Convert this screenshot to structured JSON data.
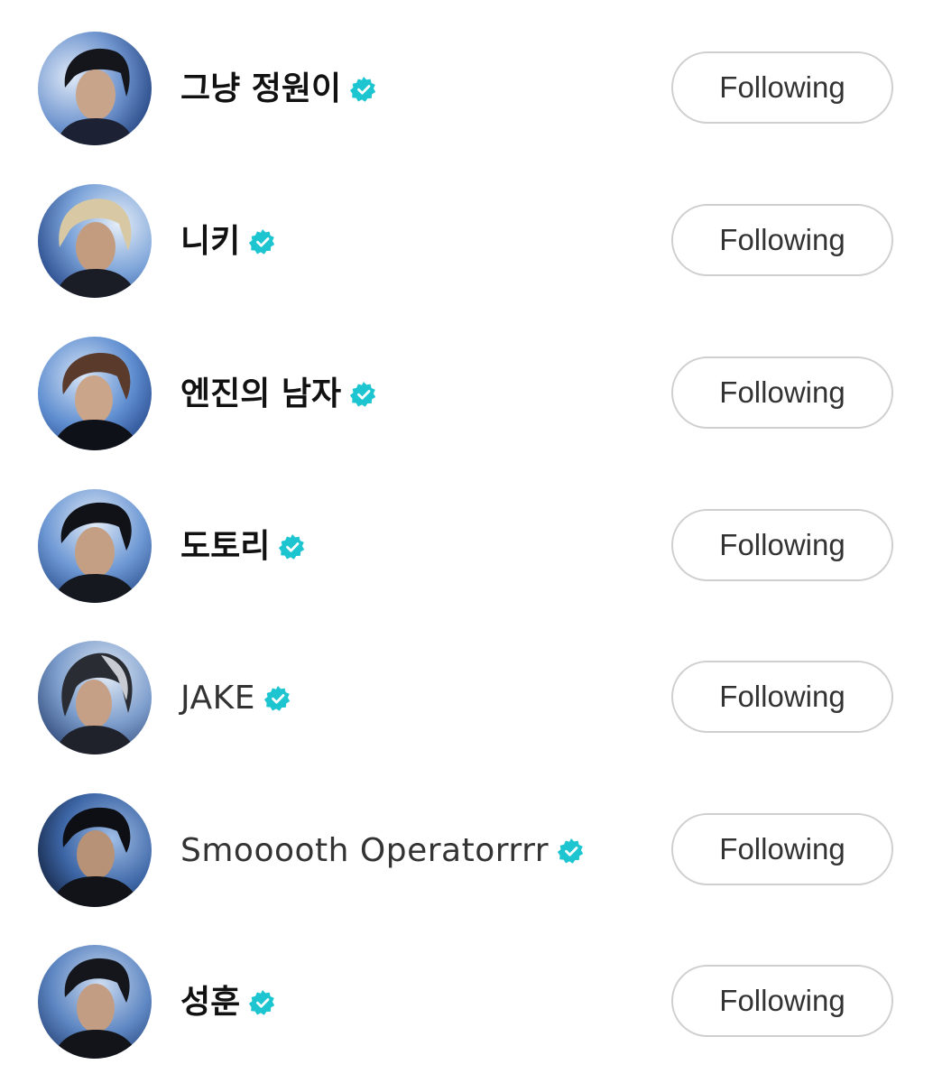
{
  "accent_color": "#1cc5cf",
  "following_list": [
    {
      "name": "그냥 정원이",
      "verified_icon": "verified-badge-icon",
      "button_label": "Following"
    },
    {
      "name": "니키",
      "verified_icon": "verified-badge-icon",
      "button_label": "Following"
    },
    {
      "name": "엔진의 남자",
      "verified_icon": "verified-badge-icon",
      "button_label": "Following"
    },
    {
      "name": "도토리",
      "verified_icon": "verified-badge-icon",
      "button_label": "Following"
    },
    {
      "name": "JAKE",
      "verified_icon": "verified-badge-icon",
      "button_label": "Following"
    },
    {
      "name": "Smooooth Operatorrrr",
      "verified_icon": "verified-badge-icon",
      "button_label": "Following"
    },
    {
      "name": "성훈",
      "verified_icon": "verified-badge-icon",
      "button_label": "Following"
    }
  ]
}
